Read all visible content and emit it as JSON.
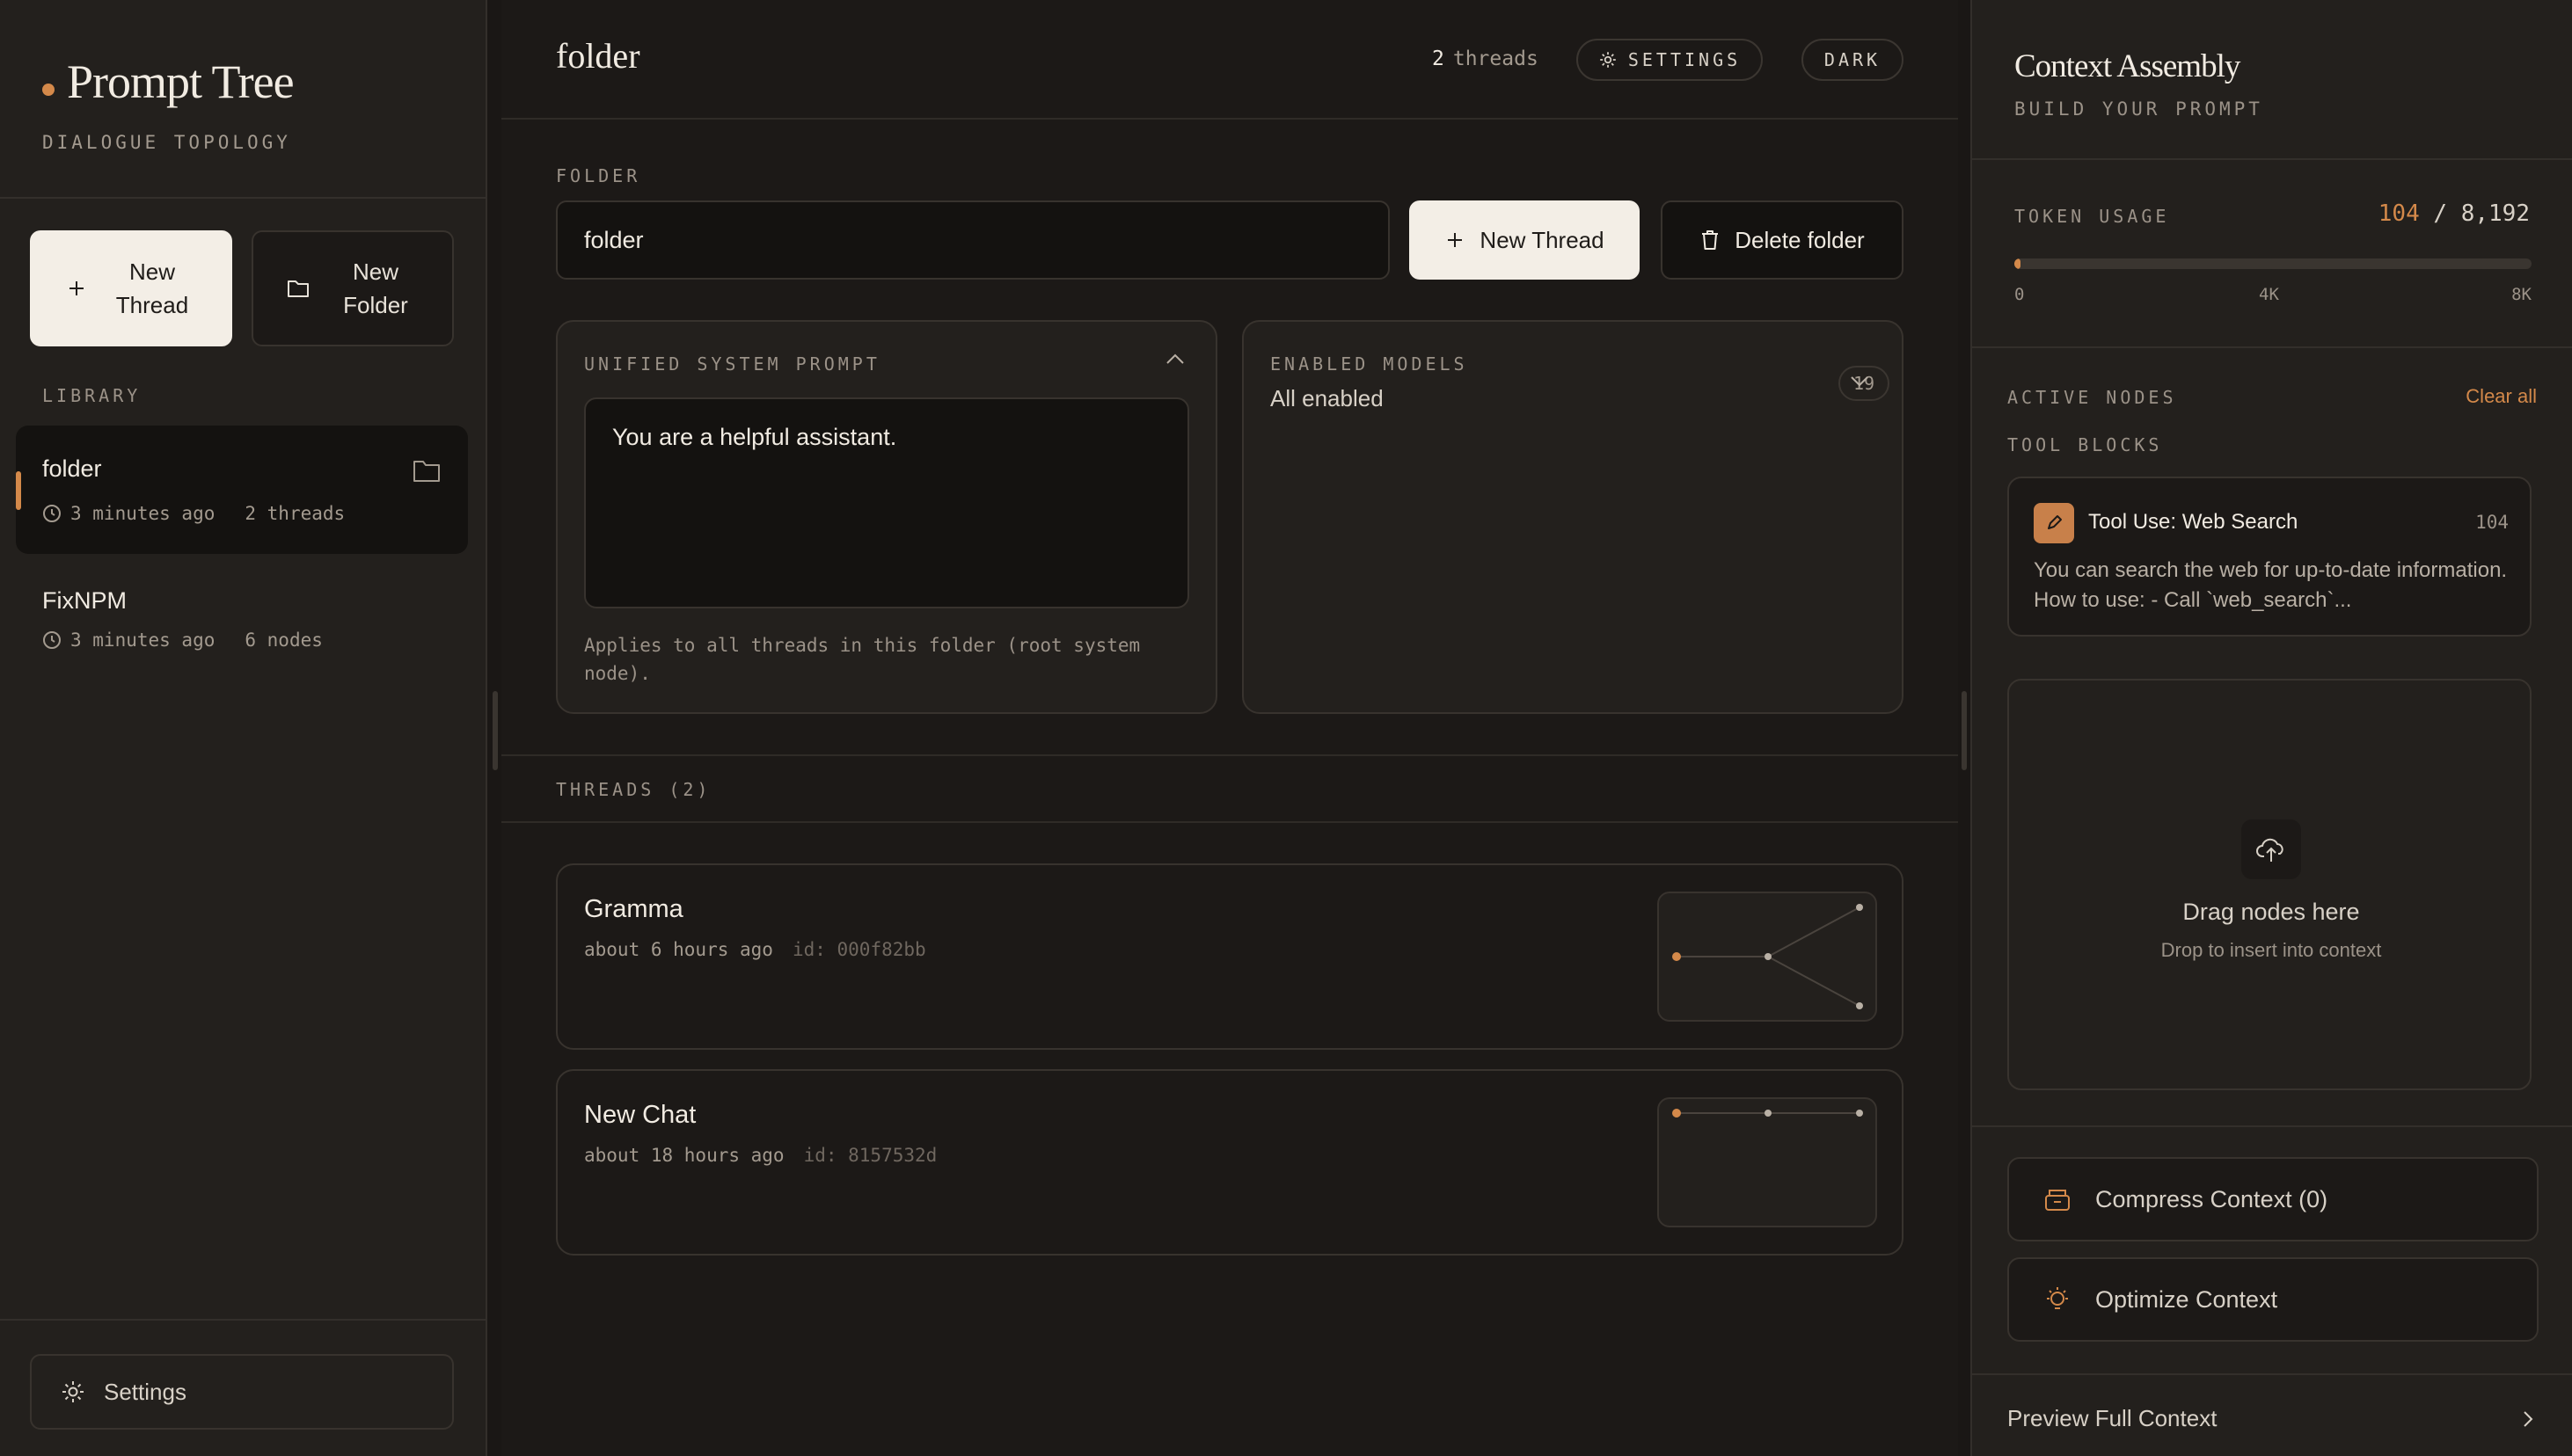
{
  "sidebar": {
    "brand": "Prompt Tree",
    "tagline": "DIALOGUE TOPOLOGY",
    "new_thread_label": "New Thread",
    "new_folder_label": "New Folder",
    "library_label": "LIBRARY",
    "items": [
      {
        "title": "folder",
        "time": "3 minutes ago",
        "count": "2 threads",
        "active": true
      },
      {
        "title": "FixNPM",
        "time": "3 minutes ago",
        "count": "6 nodes",
        "active": false
      }
    ],
    "settings_label": "Settings"
  },
  "main": {
    "title": "folder",
    "thread_count": "2",
    "thread_count_suffix": "threads",
    "settings_pill": "SETTINGS",
    "theme_pill": "DARK",
    "folder_label": "FOLDER",
    "folder_name_value": "folder",
    "new_thread_label": "New Thread",
    "delete_folder_label": "Delete folder",
    "system_prompt": {
      "caption": "UNIFIED SYSTEM PROMPT",
      "value": "You are a helpful assistant.",
      "note": "Applies to all threads in this folder (root system node)."
    },
    "models": {
      "caption": "ENABLED MODELS",
      "value": "All enabled",
      "count": "19"
    },
    "threads_label": "THREADS (2)",
    "threads": [
      {
        "title": "Gramma",
        "time": "about 6 hours ago",
        "id": "id: 000f82bb"
      },
      {
        "title": "New Chat",
        "time": "about 18 hours ago",
        "id": "id: 8157532d"
      }
    ]
  },
  "context": {
    "title": "Context Assembly",
    "subtitle": "BUILD YOUR PROMPT",
    "token_label": "TOKEN USAGE",
    "token_used": "104",
    "token_sep": " / ",
    "token_max": "8,192",
    "token_fraction": 0.0127,
    "ticks": [
      "0",
      "4K",
      "8K"
    ],
    "active_nodes_label": "ACTIVE NODES",
    "clear_all": "Clear all",
    "tool_blocks_label": "TOOL BLOCKS",
    "tool": {
      "name": "Tool Use: Web Search",
      "tokens": "104",
      "desc": "You can search the web for up-to-date information. How to use: - Call `web_search`..."
    },
    "drop_title": "Drag nodes here",
    "drop_sub": "Drop to insert into context",
    "compress_label": "Compress Context (0)",
    "optimize_label": "Optimize Context",
    "preview_label": "Preview Full Context"
  },
  "colors": {
    "accent": "#d4894a",
    "background": "#1a1715",
    "panel": "#23201d",
    "primary_button": "#f3eee6"
  }
}
